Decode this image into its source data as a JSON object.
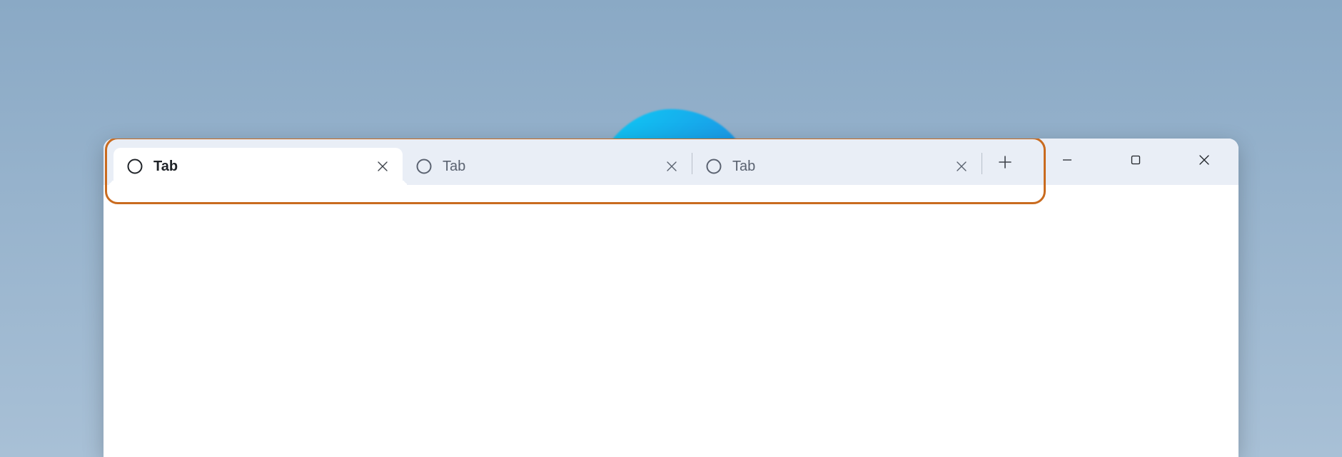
{
  "tabs": [
    {
      "label": "Tab",
      "active": true
    },
    {
      "label": "Tab",
      "active": false
    },
    {
      "label": "Tab",
      "active": false
    }
  ],
  "icons": {
    "favicon": "circle-icon",
    "close_tab": "close-icon",
    "new_tab": "plus-icon",
    "minimize": "minimize-icon",
    "maximize": "maximize-icon",
    "close_window": "close-icon"
  },
  "colors": {
    "highlight_border": "#c96b1f",
    "titlebar_bg": "#e9eef6",
    "window_bg": "#ffffff",
    "desktop_gradient_top": "#8aa9c5",
    "desktop_gradient_bottom": "#a8c0d6",
    "active_text": "#1f2328",
    "inactive_text": "#5a6270"
  }
}
